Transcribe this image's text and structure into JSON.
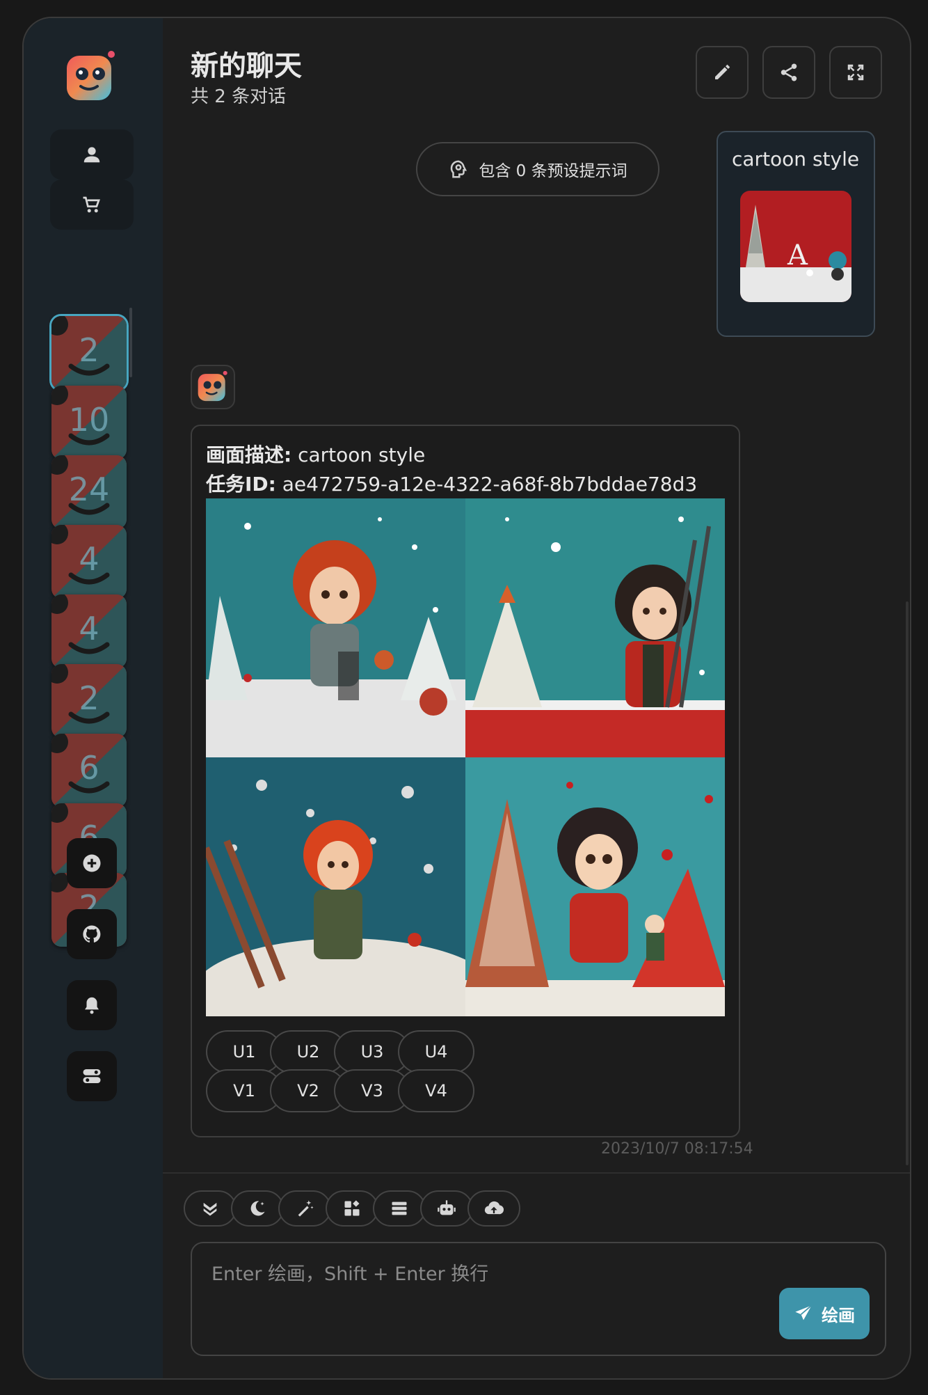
{
  "header": {
    "title": "新的聊天",
    "subtitle": "共 2 条对话",
    "buttons": [
      {
        "name": "rename-button",
        "icon": "pencil-icon"
      },
      {
        "name": "share-button",
        "icon": "share-icon"
      },
      {
        "name": "fullscreen-button",
        "icon": "expand-icon"
      }
    ]
  },
  "sidebar": {
    "top_buttons": [
      {
        "name": "user-button",
        "icon": "user-icon"
      },
      {
        "name": "shop-button",
        "icon": "cart-icon"
      }
    ],
    "sessions": [
      "2",
      "10",
      "24",
      "4",
      "4",
      "2",
      "6",
      "6",
      "2"
    ],
    "active_session": 0,
    "bottom_buttons": [
      {
        "name": "new-chat-button",
        "icon": "plus-circle-icon"
      },
      {
        "name": "github-button",
        "icon": "github-icon"
      },
      {
        "name": "notification-button",
        "icon": "bell-icon"
      },
      {
        "name": "settings-button",
        "icon": "toggle-icon"
      }
    ]
  },
  "preset": {
    "label": "包含 0 条预设提示词",
    "icon": "brain-icon"
  },
  "messages": {
    "user": {
      "text": "cartoon style"
    },
    "bot": {
      "desc_label": "画面描述:",
      "desc_value": " cartoon style",
      "task_label": "任务ID:",
      "task_value": " ae472759-a12e-4322-a68f-8b7bddae78d3",
      "upscale_buttons": [
        "U1",
        "U2",
        "U3",
        "U4"
      ],
      "variation_buttons": [
        "V1",
        "V2",
        "V3",
        "V4"
      ],
      "timestamp": "2023/10/7 08:17:54"
    }
  },
  "toolbar": [
    {
      "name": "scroll-bottom-button",
      "icon": "double-chevron-down-icon"
    },
    {
      "name": "theme-button",
      "icon": "moon-icon"
    },
    {
      "name": "prompt-button",
      "icon": "magic-wand-icon"
    },
    {
      "name": "masks-button",
      "icon": "grid-icon"
    },
    {
      "name": "clear-button",
      "icon": "list-icon"
    },
    {
      "name": "model-button",
      "icon": "robot-icon"
    },
    {
      "name": "upload-button",
      "icon": "cloud-upload-icon"
    }
  ],
  "composer": {
    "placeholder": "Enter 绘画，Shift + Enter 换行",
    "send_label": "绘画",
    "send_icon": "paper-plane-icon"
  },
  "colors": {
    "accent": "#3e94aa",
    "sidebar": "#1b2329",
    "background": "#1e1e1e"
  }
}
